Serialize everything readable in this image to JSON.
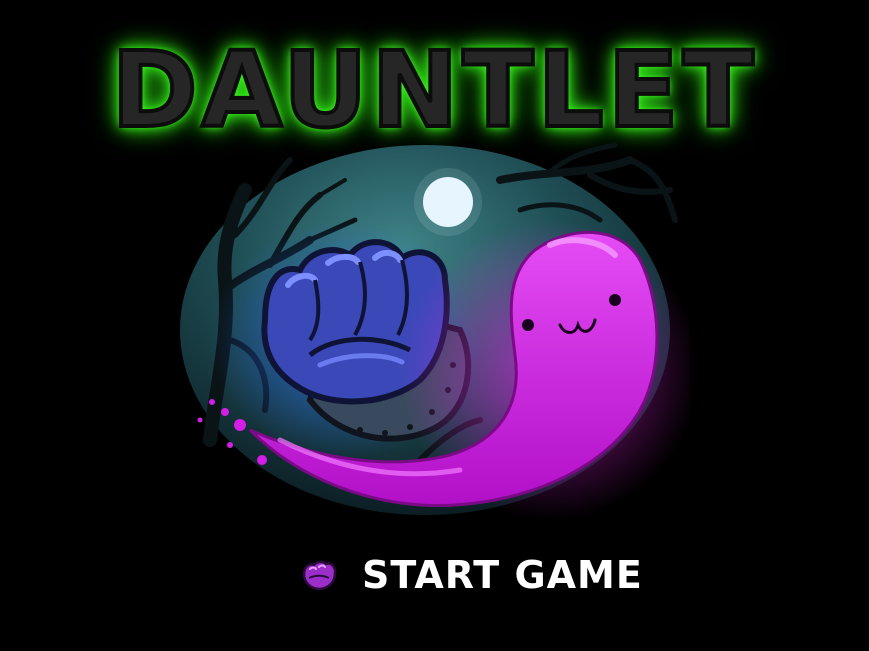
{
  "game": {
    "title": "DAUNTLET",
    "menu": {
      "start_label": "START GAME",
      "cursor_icon": "fist-cursor-icon"
    }
  },
  "colors": {
    "background": "#000000",
    "title_glow": "#3cff1e",
    "title_fill": "#262626",
    "ghost": "#d21ee6",
    "fist": "#3c4cc8",
    "moon": "#e6f5ff",
    "menu_text": "#ffffff"
  }
}
